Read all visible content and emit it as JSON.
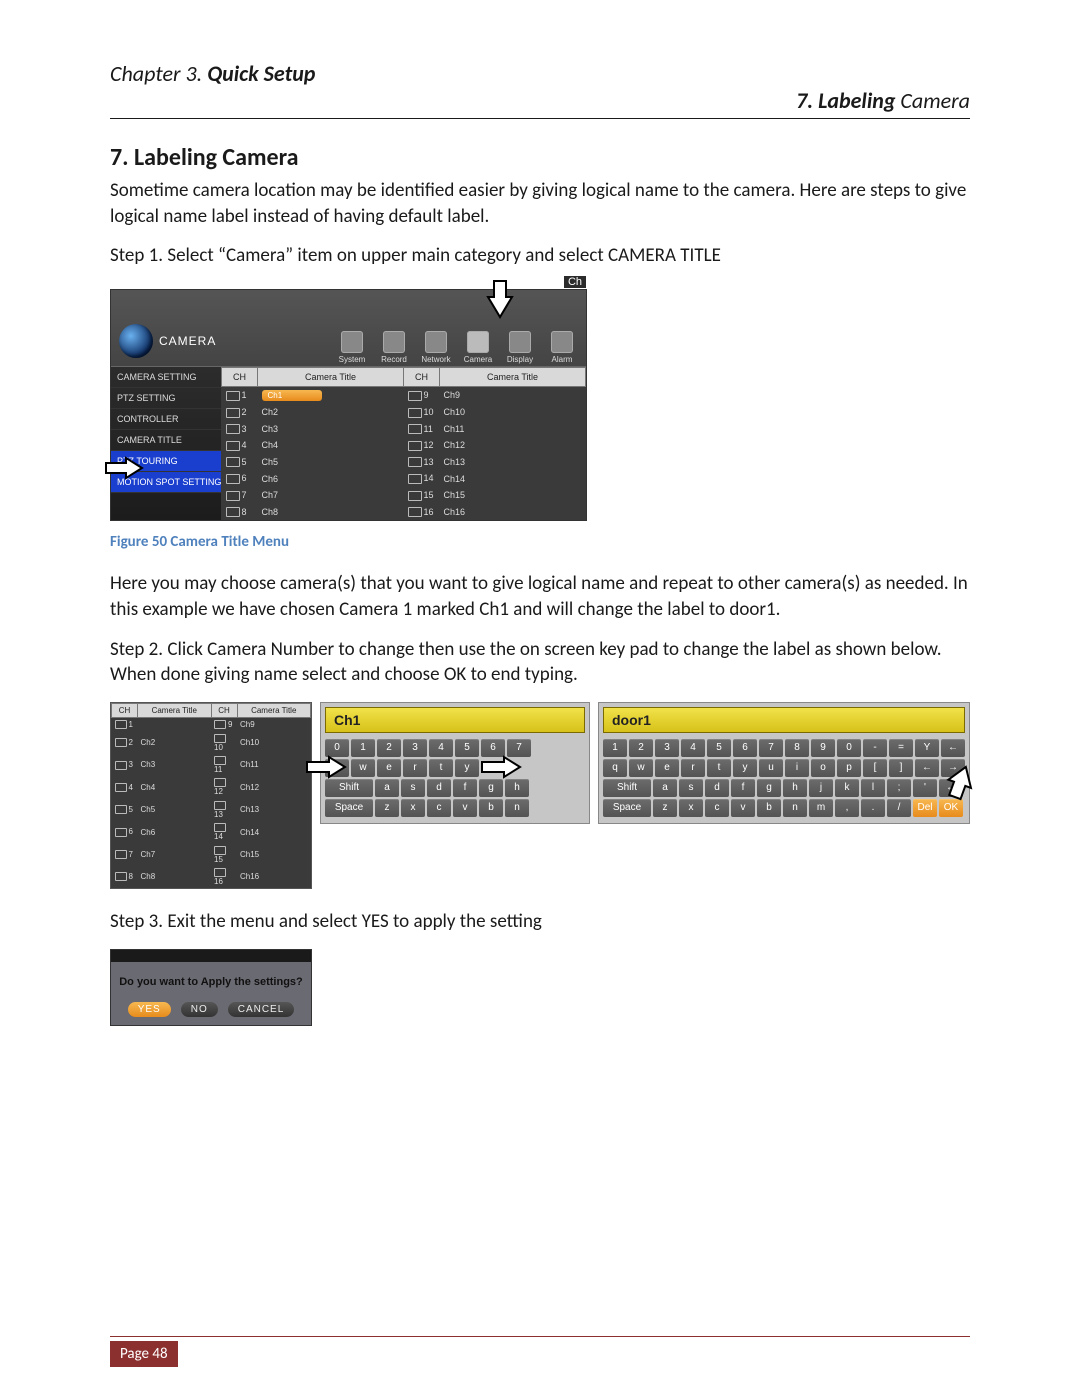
{
  "chapter": {
    "prefix": "Chapter 3.",
    "title": "Quick Setup"
  },
  "section": {
    "num": "7.",
    "title_bold": "Labeling",
    "title_rest": "Camera"
  },
  "heading": "7. Labeling Camera",
  "p_intro": "Sometime camera location may be identified easier by giving logical name to the camera. Here are steps to give logical name label instead of having default label.",
  "p_step1": "Step 1. Select “Camera” item on upper main category and select CAMERA TITLE",
  "fig50_caption": "Figure 50 Camera Title Menu",
  "p_after_fig50": "Here you may choose camera(s) that you want to give logical name and repeat to other camera(s) as needed. In this example we have chosen Camera 1 marked Ch1 and will change the label to door1.",
  "p_step2": "Step 2. Click Camera Number to change then use the on screen key pad to change the label as shown below. When done giving name select and choose OK to end typing.",
  "p_step3": "Step 3. Exit the menu and select YES to apply the setting",
  "page_num": "Page 48",
  "fig50": {
    "ch_tag": "Ch",
    "logo": "CAMERA",
    "nav": [
      "System",
      "Record",
      "Network",
      "Camera",
      "Display",
      "Alarm"
    ],
    "sidebar": [
      "CAMERA SETTING",
      "PTZ SETTING",
      "CONTROLLER",
      "CAMERA TITLE",
      "PTZ TOURING",
      "MOTION SPOT SETTING"
    ],
    "th_ch": "CH",
    "th_title": "Camera Title",
    "left": [
      {
        "ch": "1",
        "title": "Ch1",
        "sel": true
      },
      {
        "ch": "2",
        "title": "Ch2"
      },
      {
        "ch": "3",
        "title": "Ch3"
      },
      {
        "ch": "4",
        "title": "Ch4"
      },
      {
        "ch": "5",
        "title": "Ch5"
      },
      {
        "ch": "6",
        "title": "Ch6"
      },
      {
        "ch": "7",
        "title": "Ch7"
      },
      {
        "ch": "8",
        "title": "Ch8"
      }
    ],
    "right": [
      {
        "ch": "9",
        "title": "Ch9"
      },
      {
        "ch": "10",
        "title": "Ch10"
      },
      {
        "ch": "11",
        "title": "Ch11"
      },
      {
        "ch": "12",
        "title": "Ch12"
      },
      {
        "ch": "13",
        "title": "Ch13"
      },
      {
        "ch": "14",
        "title": "Ch14"
      },
      {
        "ch": "15",
        "title": "Ch15"
      },
      {
        "ch": "16",
        "title": "Ch16"
      }
    ]
  },
  "mini": {
    "th_ch": "CH",
    "th_title": "Camera Title",
    "left": [
      {
        "ch": "1",
        "title": "",
        "sel": true
      },
      {
        "ch": "2",
        "title": "Ch2"
      },
      {
        "ch": "3",
        "title": "Ch3"
      },
      {
        "ch": "4",
        "title": "Ch4"
      },
      {
        "ch": "5",
        "title": "Ch5"
      },
      {
        "ch": "6",
        "title": "Ch6"
      },
      {
        "ch": "7",
        "title": "Ch7"
      },
      {
        "ch": "8",
        "title": "Ch8"
      }
    ],
    "right": [
      {
        "ch": "9",
        "title": "Ch9"
      },
      {
        "ch": "10",
        "title": "Ch10"
      },
      {
        "ch": "11",
        "title": "Ch11"
      },
      {
        "ch": "12",
        "title": "Ch12"
      },
      {
        "ch": "13",
        "title": "Ch13"
      },
      {
        "ch": "14",
        "title": "Ch14"
      },
      {
        "ch": "15",
        "title": "Ch15"
      },
      {
        "ch": "16",
        "title": "Ch16"
      }
    ]
  },
  "kbd1": {
    "field": "Ch1",
    "r1": [
      "0",
      "1",
      "2",
      "3",
      "4",
      "5",
      "6",
      "7"
    ],
    "r2": [
      "q",
      "w",
      "e",
      "r",
      "t",
      "y"
    ],
    "r3": [
      "Shift",
      "a",
      "s",
      "d",
      "f",
      "g",
      "h"
    ],
    "r4": [
      "Space",
      "z",
      "x",
      "c",
      "v",
      "b",
      "n"
    ]
  },
  "kbd2": {
    "field": "door1",
    "r1": [
      "1",
      "2",
      "3",
      "4",
      "5",
      "6",
      "7",
      "8",
      "9",
      "0",
      "-",
      "=",
      "Y",
      "←"
    ],
    "r2": [
      "q",
      "w",
      "e",
      "r",
      "t",
      "y",
      "u",
      "i",
      "o",
      "p",
      "[",
      "]",
      "←",
      "→"
    ],
    "r3": [
      "Shift",
      "a",
      "s",
      "d",
      "f",
      "g",
      "h",
      "j",
      "k",
      "l",
      ";",
      "'",
      "←"
    ],
    "r4": [
      "Space",
      "z",
      "x",
      "c",
      "v",
      "b",
      "n",
      "m",
      ",",
      ".",
      "/",
      "Del",
      "OK"
    ]
  },
  "apply": {
    "msg": "Do you want to Apply the settings?",
    "yes": "YES",
    "no": "NO",
    "cancel": "CANCEL"
  }
}
